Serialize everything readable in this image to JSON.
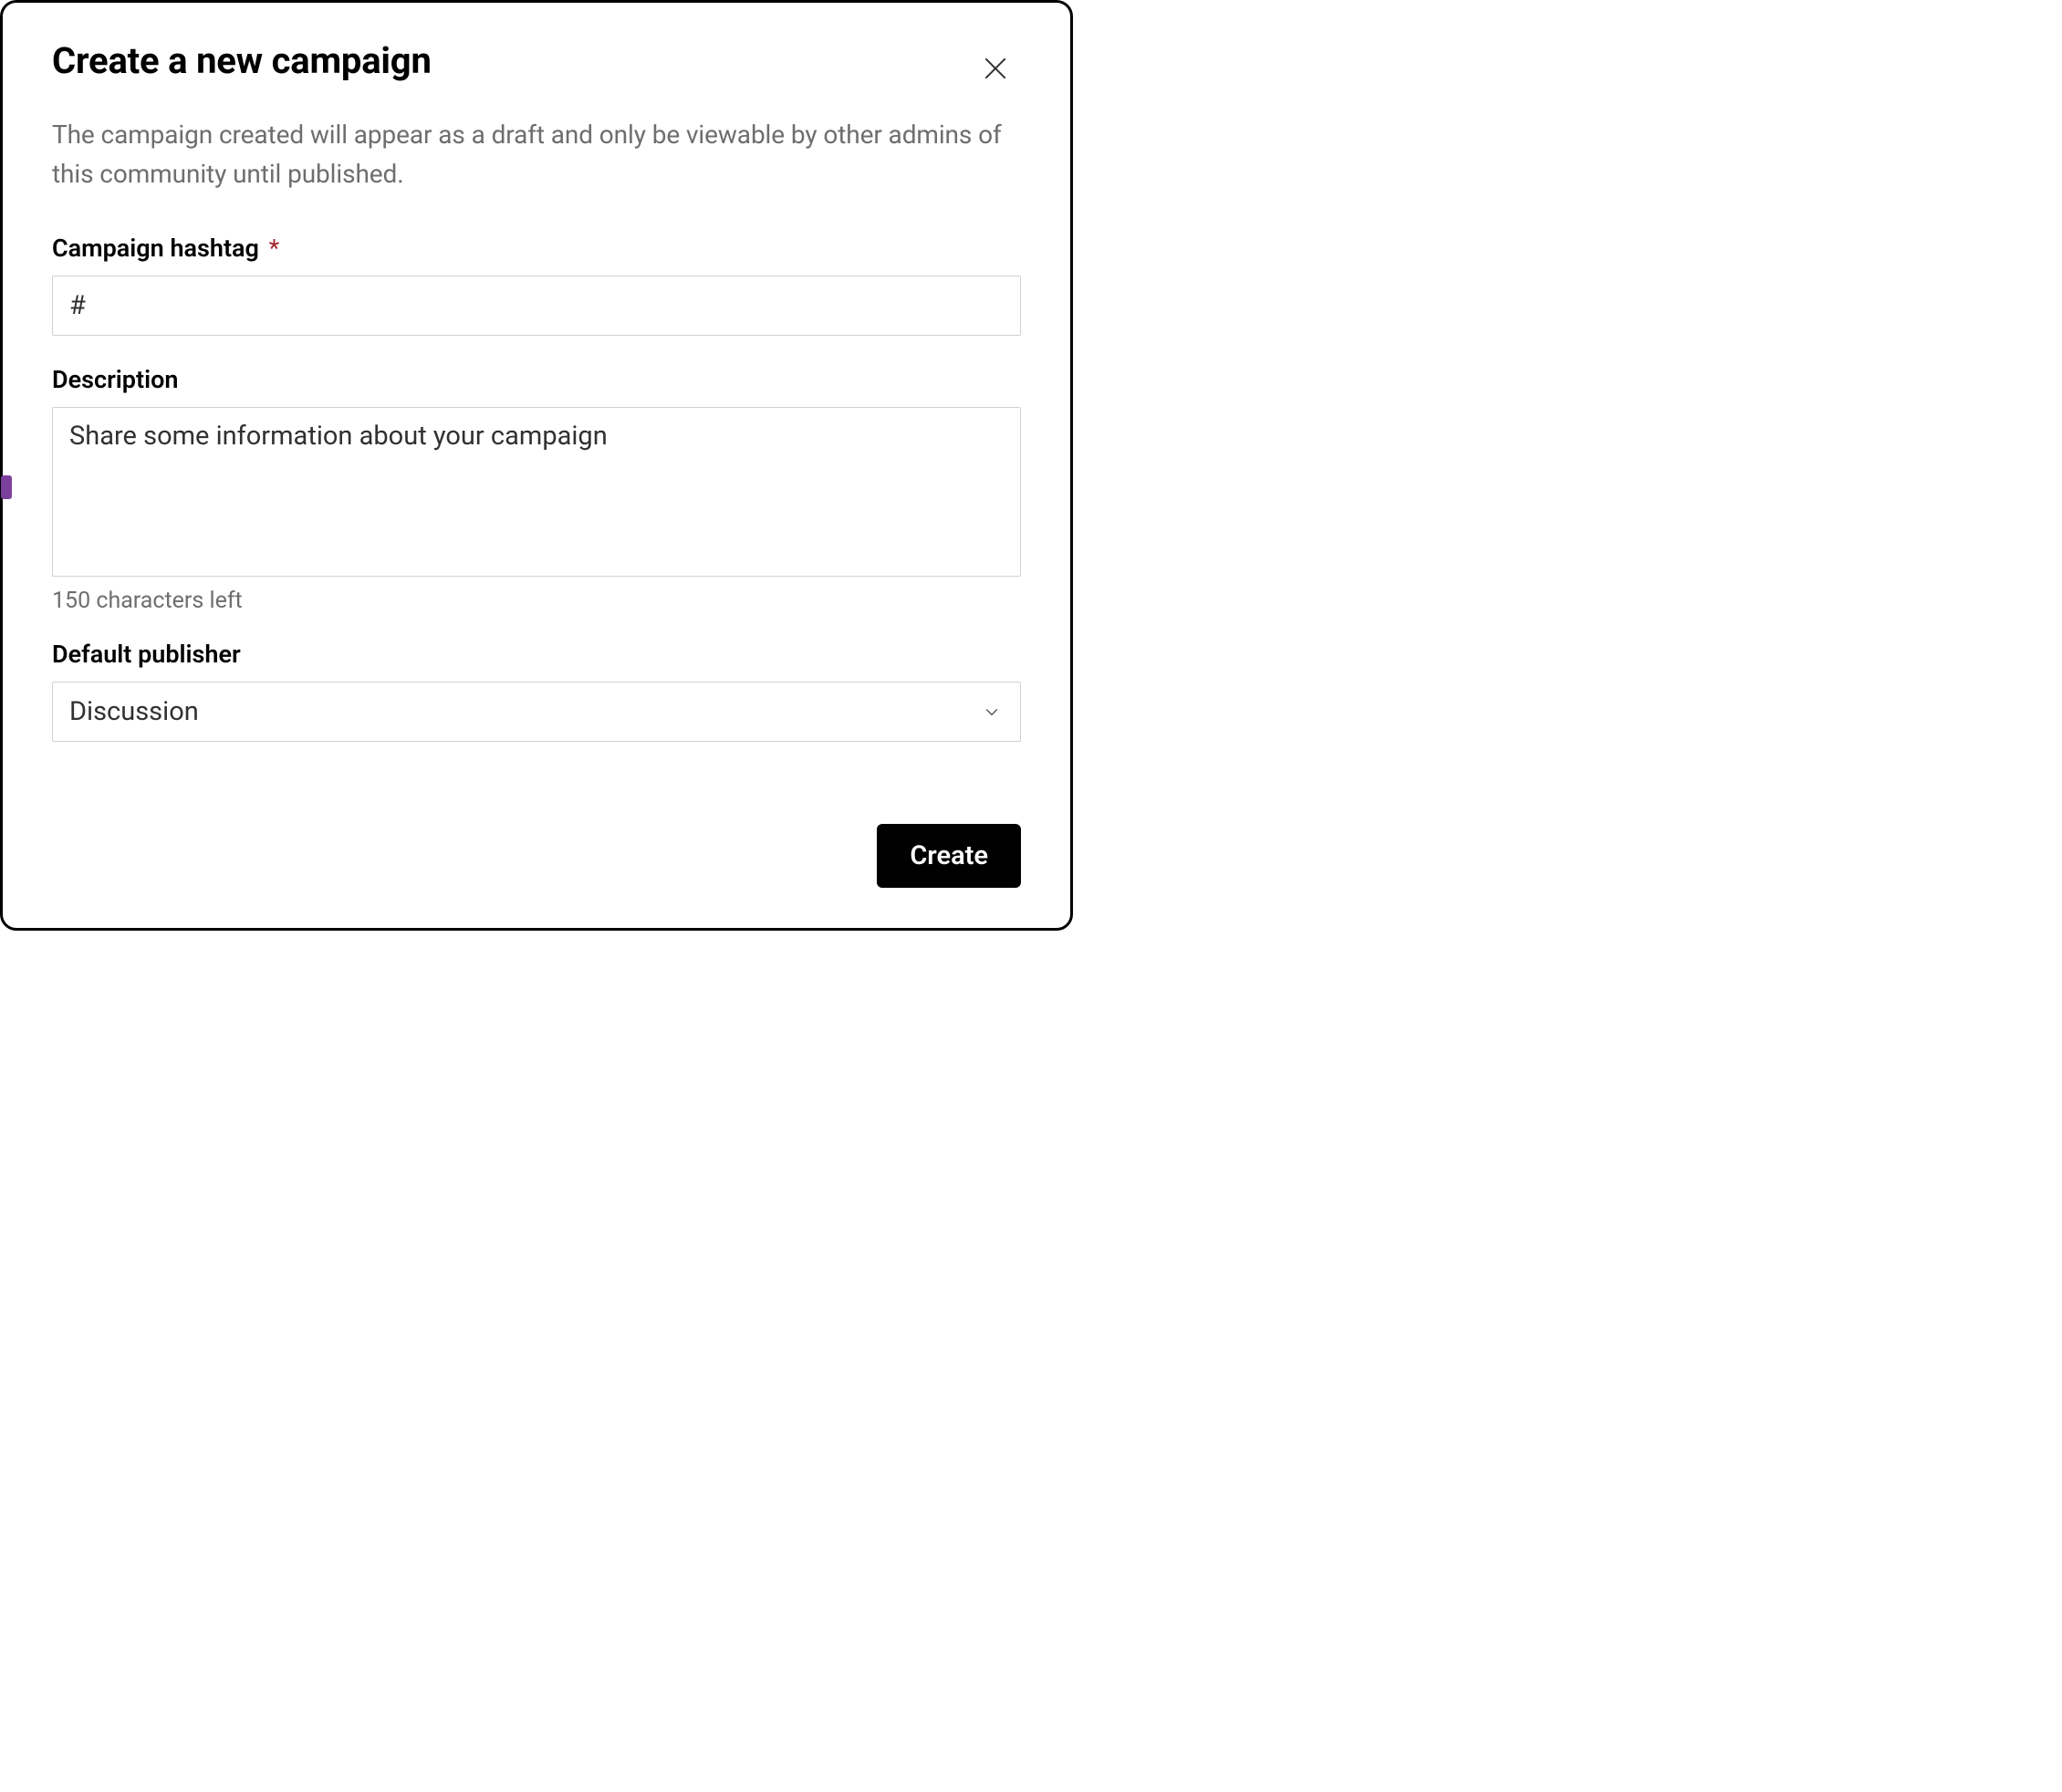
{
  "dialog": {
    "title": "Create a new campaign",
    "description": "The campaign created will appear as a draft and only be viewable by other admins of this community until published."
  },
  "form": {
    "hashtag": {
      "label": "Campaign hashtag",
      "required_mark": "*",
      "value": "#"
    },
    "description": {
      "label": "Description",
      "placeholder": "Share some information about your campaign",
      "value": "",
      "char_count_text": "150 characters left"
    },
    "publisher": {
      "label": "Default publisher",
      "selected": "Discussion"
    }
  },
  "buttons": {
    "create": "Create"
  }
}
